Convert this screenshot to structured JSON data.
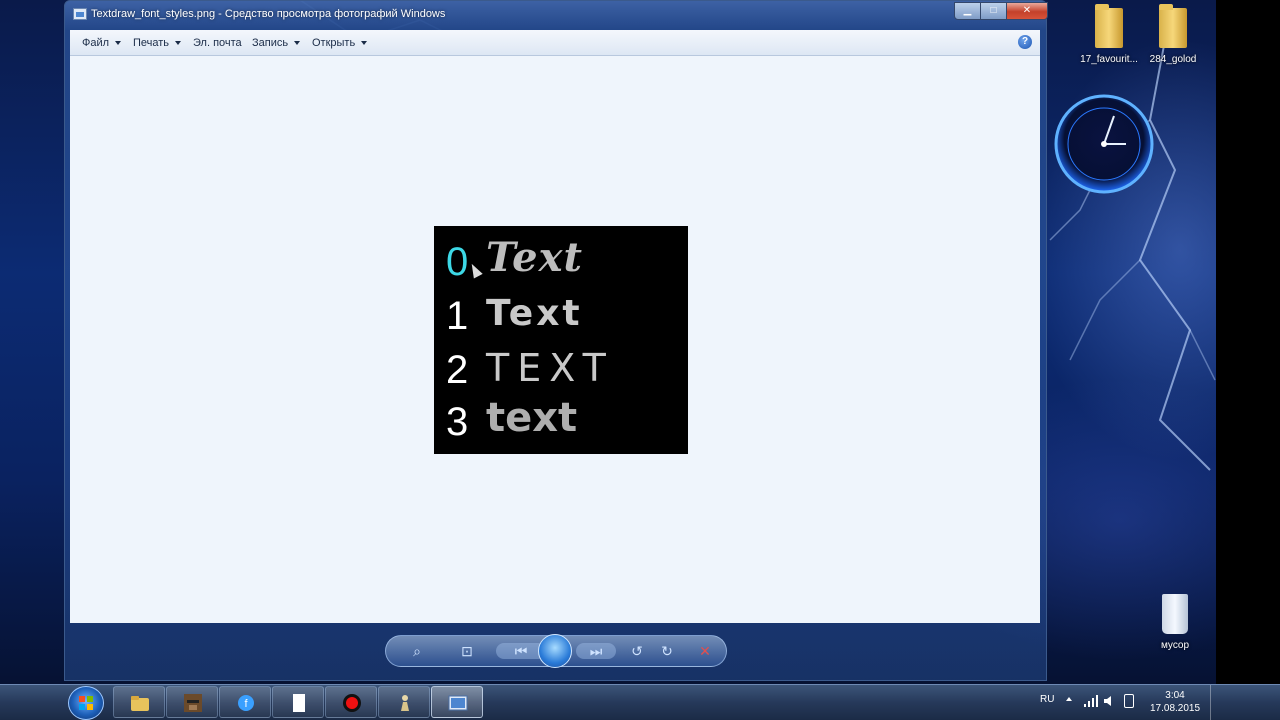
{
  "window": {
    "title": "Textdraw_font_styles.png - Средство просмотра фотографий Windows",
    "menu": [
      {
        "label": "Файл",
        "dropdown": true
      },
      {
        "label": "Печать",
        "dropdown": true
      },
      {
        "label": "Эл. почта",
        "dropdown": false
      },
      {
        "label": "Запись",
        "dropdown": true
      },
      {
        "label": "Открыть",
        "dropdown": true
      }
    ],
    "help": "?"
  },
  "image": {
    "rows": [
      {
        "number": "0",
        "text": "Text"
      },
      {
        "number": "1",
        "text": "Text"
      },
      {
        "number": "2",
        "text": "TEXT"
      },
      {
        "number": "3",
        "text": "text"
      }
    ]
  },
  "desktop": {
    "icons": [
      {
        "label": "17_favourit...",
        "icon": "folder-icon"
      },
      {
        "label": "284_golod",
        "icon": "folder-icon"
      },
      {
        "label": "мусор",
        "icon": "recycle-bin-icon"
      }
    ]
  },
  "taskbar": {
    "tray": {
      "lang": "RU",
      "time": "3:04",
      "date": "17.08.2015"
    }
  },
  "colors": {
    "selected_number": "#3dd8e6",
    "canvas": "#eff5fc",
    "taskbar": "#26395a"
  }
}
